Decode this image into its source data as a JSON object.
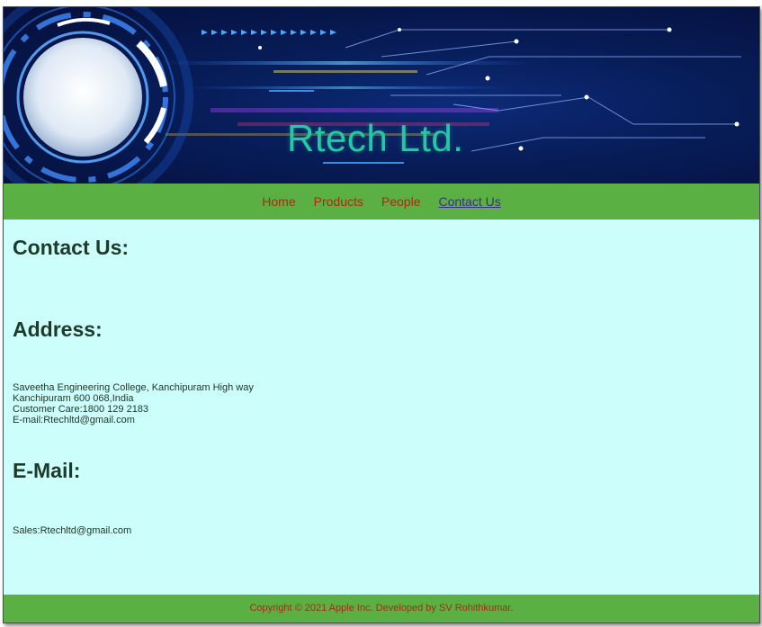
{
  "banner": {
    "brand": "Rtech Ltd."
  },
  "nav": {
    "items": [
      {
        "label": "Home",
        "active": false
      },
      {
        "label": "Products",
        "active": false
      },
      {
        "label": "People",
        "active": false
      },
      {
        "label": "Contact Us",
        "active": true
      }
    ]
  },
  "main": {
    "contact_heading": "Contact Us:",
    "address_heading": "Address:",
    "address_lines": [
      "Saveetha Engineering College, Kanchipuram High way",
      "Kanchipuram 600 068,India",
      "Customer Care:1800 129 2183",
      "E-mail:Rtechltd@gmail.com"
    ],
    "email_heading": "E-Mail:",
    "email_lines": [
      "Sales:Rtechltd@gmail.com"
    ]
  },
  "footer": {
    "text": "Copyright © 2021 Apple Inc. Developed by SV Rohithkumar."
  },
  "colors": {
    "nav_bg": "#5bb043",
    "content_bg": "#ccfffb",
    "link": "#a12f13",
    "active_link": "#3d2b8f",
    "brand": "#23c9a4"
  }
}
